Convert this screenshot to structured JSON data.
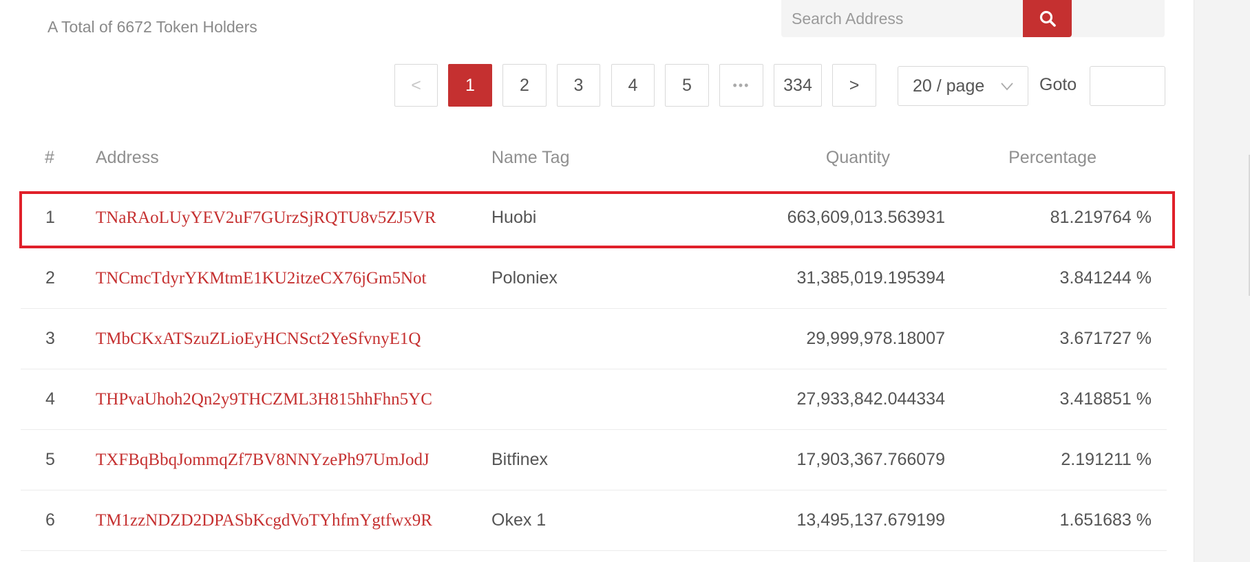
{
  "summary": {
    "total_text": "A Total of 6672 Token Holders"
  },
  "search": {
    "placeholder": "Search Address",
    "icon": "search-icon"
  },
  "pagination": {
    "prev_label": "<",
    "pages": [
      "1",
      "2",
      "3",
      "4",
      "5"
    ],
    "ellipsis": "•••",
    "last_page": "334",
    "next_label": ">",
    "current_page": "1",
    "page_size": "20 / page",
    "goto_label": "Goto",
    "goto_value": ""
  },
  "table": {
    "headers": {
      "index": "#",
      "address": "Address",
      "name_tag": "Name Tag",
      "quantity": "Quantity",
      "percentage": "Percentage"
    },
    "rows": [
      {
        "index": "1",
        "address": "TNaRAoLUyYEV2uF7GUrzSjRQTU8v5ZJ5VR",
        "name_tag": "Huobi",
        "quantity": "663,609,013.563931",
        "percentage": "81.219764 %"
      },
      {
        "index": "2",
        "address": "TNCmcTdyrYKMtmE1KU2itzeCX76jGm5Not",
        "name_tag": "Poloniex",
        "quantity": "31,385,019.195394",
        "percentage": "3.841244 %"
      },
      {
        "index": "3",
        "address": "TMbCKxATSzuZLioEyHCNSct2YeSfvnyE1Q",
        "name_tag": "",
        "quantity": "29,999,978.18007",
        "percentage": "3.671727 %"
      },
      {
        "index": "4",
        "address": "THPvaUhoh2Qn2y9THCZML3H815hhFhn5YC",
        "name_tag": "",
        "quantity": "27,933,842.044334",
        "percentage": "3.418851 %"
      },
      {
        "index": "5",
        "address": "TXFBqBbqJommqZf7BV8NNYzePh97UmJodJ",
        "name_tag": "Bitfinex",
        "quantity": "17,903,367.766079",
        "percentage": "2.191211 %"
      },
      {
        "index": "6",
        "address": "TM1zzNDZD2DPASbKcgdVoTYhfmYgtfwx9R",
        "name_tag": "Okex 1",
        "quantity": "13,495,137.679199",
        "percentage": "1.651683 %"
      }
    ]
  },
  "colors": {
    "accent": "#c53030",
    "highlight_border": "#e0202a",
    "muted_text": "#8f8f8f",
    "body_text": "#555555"
  }
}
